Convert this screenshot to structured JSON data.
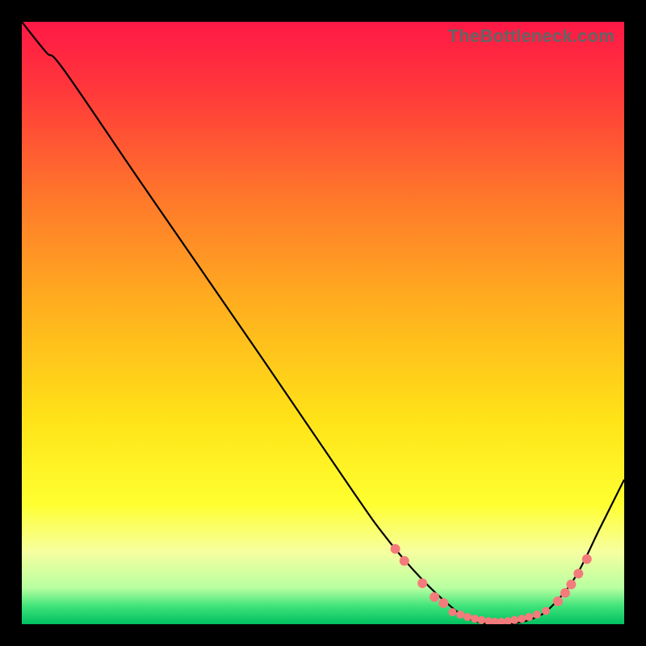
{
  "attribution": "TheBottleneck.com",
  "chart_data": {
    "type": "line",
    "title": "",
    "xlabel": "",
    "ylabel": "",
    "xlim": [
      0,
      100
    ],
    "ylim": [
      0,
      100
    ],
    "background_gradient_stops": [
      {
        "pos": 0.0,
        "color": "#ff1846"
      },
      {
        "pos": 0.12,
        "color": "#ff3a3a"
      },
      {
        "pos": 0.3,
        "color": "#ff7a2a"
      },
      {
        "pos": 0.48,
        "color": "#ffb21e"
      },
      {
        "pos": 0.66,
        "color": "#ffe318"
      },
      {
        "pos": 0.8,
        "color": "#ffff30"
      },
      {
        "pos": 0.88,
        "color": "#f6ffa0"
      },
      {
        "pos": 0.94,
        "color": "#b8ffa0"
      },
      {
        "pos": 0.97,
        "color": "#40e37a"
      },
      {
        "pos": 1.0,
        "color": "#00c060"
      }
    ],
    "series": [
      {
        "name": "bottleneck-curve",
        "x": [
          0,
          4,
          7,
          20,
          40,
          55,
          60,
          65,
          70,
          74,
          78,
          81,
          85,
          88,
          92,
          96,
          100
        ],
        "y": [
          100,
          95,
          92,
          73,
          44,
          22,
          15,
          9,
          4,
          1,
          0,
          0,
          1,
          3,
          8,
          16,
          24
        ]
      }
    ],
    "marker_clusters": [
      {
        "name": "left-descent-markers",
        "color": "#f47b7b",
        "radius": 6,
        "points": [
          {
            "x": 62.0,
            "y": 12.5
          },
          {
            "x": 63.5,
            "y": 10.5
          },
          {
            "x": 66.5,
            "y": 6.8
          },
          {
            "x": 68.5,
            "y": 4.5
          },
          {
            "x": 70.0,
            "y": 3.5
          }
        ]
      },
      {
        "name": "valley-floor-markers",
        "color": "#f47b7b",
        "radius": 5,
        "points": [
          {
            "x": 71.5,
            "y": 2.0
          },
          {
            "x": 72.8,
            "y": 1.6
          },
          {
            "x": 74.0,
            "y": 1.2
          },
          {
            "x": 75.2,
            "y": 0.9
          },
          {
            "x": 76.3,
            "y": 0.7
          },
          {
            "x": 77.5,
            "y": 0.5
          },
          {
            "x": 78.5,
            "y": 0.4
          },
          {
            "x": 79.6,
            "y": 0.4
          },
          {
            "x": 80.7,
            "y": 0.5
          },
          {
            "x": 81.8,
            "y": 0.7
          },
          {
            "x": 83.0,
            "y": 0.9
          },
          {
            "x": 84.2,
            "y": 1.2
          },
          {
            "x": 85.5,
            "y": 1.6
          },
          {
            "x": 87.0,
            "y": 2.2
          }
        ]
      },
      {
        "name": "right-ascent-markers",
        "color": "#f47b7b",
        "radius": 6,
        "points": [
          {
            "x": 89.0,
            "y": 3.8
          },
          {
            "x": 90.2,
            "y": 5.2
          },
          {
            "x": 91.2,
            "y": 6.6
          },
          {
            "x": 92.4,
            "y": 8.4
          },
          {
            "x": 93.8,
            "y": 10.8
          }
        ]
      }
    ]
  }
}
